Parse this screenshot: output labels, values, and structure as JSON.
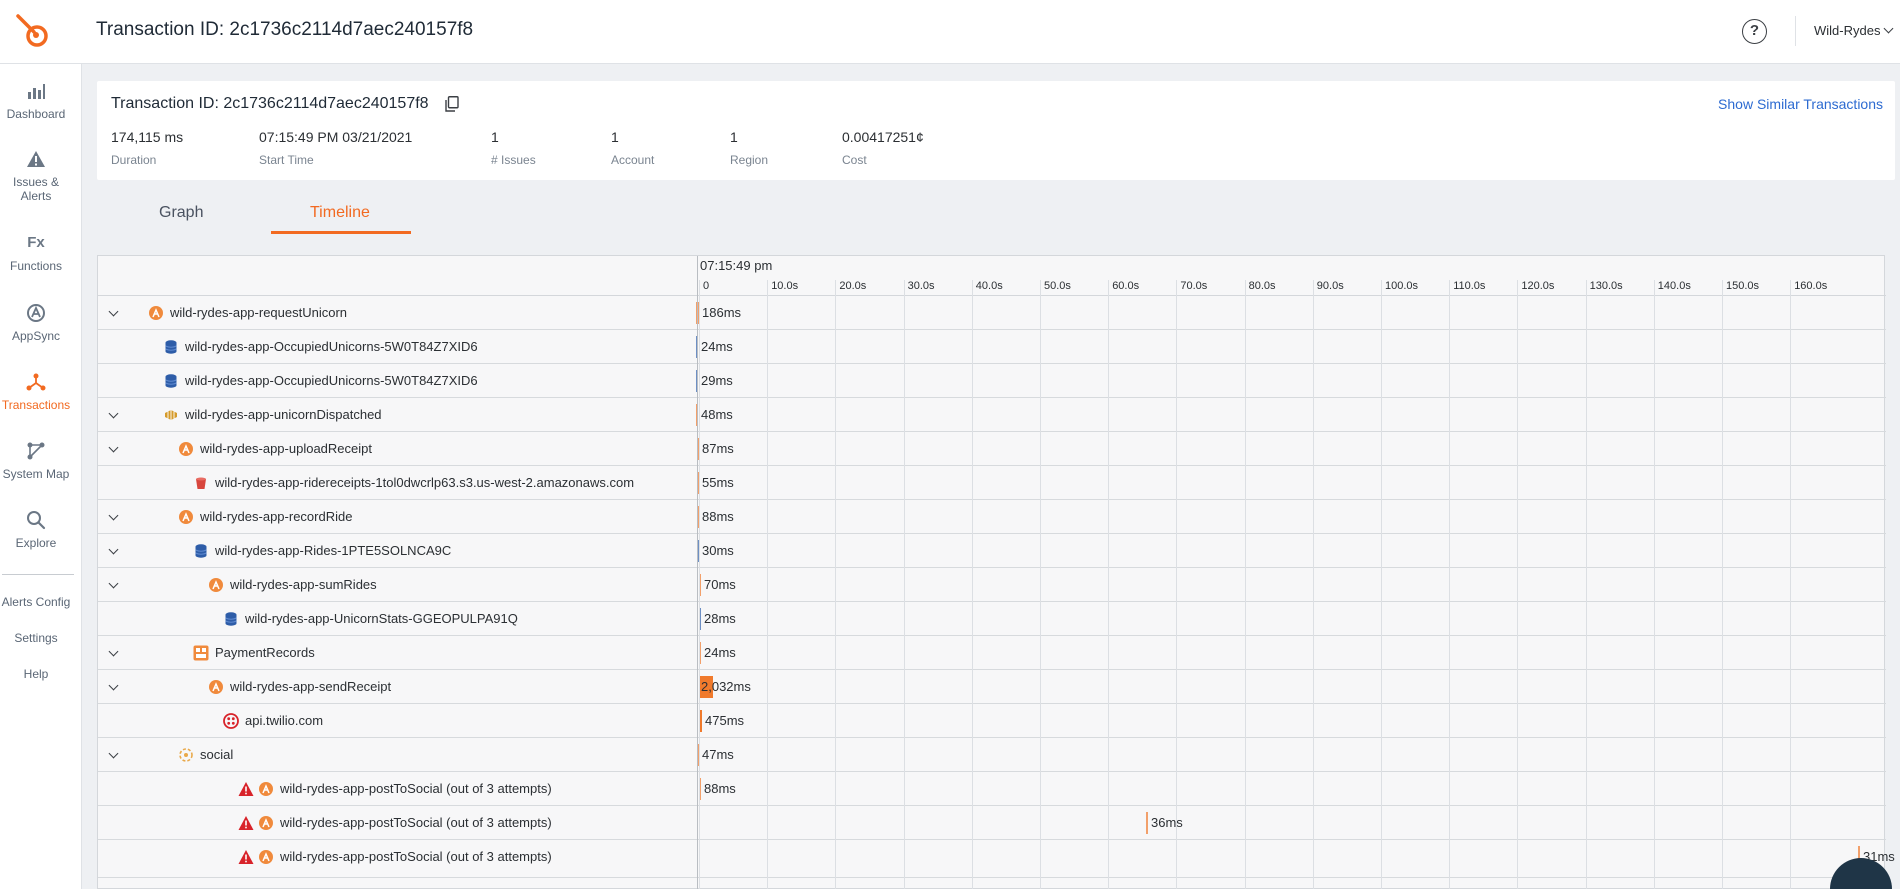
{
  "app": {
    "title": "Transaction ID: 2c1736c2114d7aec240157f8",
    "help_label": "?",
    "account": "Wild-Rydes"
  },
  "sidebar": {
    "items": [
      {
        "label": "Dashboard",
        "icon": "bar-chart-icon"
      },
      {
        "label": "Issues & Alerts",
        "icon": "warning-icon"
      },
      {
        "label": "Functions",
        "icon": "function-icon"
      },
      {
        "label": "AppSync",
        "icon": "appsync-icon"
      },
      {
        "label": "Transactions",
        "icon": "transactions-icon",
        "active": true
      },
      {
        "label": "System Map",
        "icon": "system-map-icon"
      },
      {
        "label": "Explore",
        "icon": "search-icon"
      }
    ],
    "links": [
      "Alerts Config",
      "Settings",
      "Help"
    ],
    "fx_glyph": "Fx"
  },
  "summary": {
    "title": "Transaction ID: 2c1736c2114d7aec240157f8",
    "similar_link": "Show Similar Transactions",
    "metrics": [
      {
        "value": "174,115 ms",
        "label": "Duration"
      },
      {
        "value": "07:15:49 PM 03/21/2021",
        "label": "Start Time"
      },
      {
        "value": "1",
        "label": "# Issues"
      },
      {
        "value": "1",
        "label": "Account"
      },
      {
        "value": "1",
        "label": "Region"
      },
      {
        "value": "0.00417251¢",
        "label": "Cost"
      }
    ]
  },
  "tabs": [
    {
      "label": "Graph",
      "active": false
    },
    {
      "label": "Timeline",
      "active": true
    }
  ],
  "timeline": {
    "start_time": "07:15:49 pm",
    "ticks": [
      "0",
      "10.0s",
      "20.0s",
      "30.0s",
      "40.0s",
      "50.0s",
      "60.0s",
      "70.0s",
      "80.0s",
      "90.0s",
      "100.0s",
      "110.0s",
      "120.0s",
      "130.0s",
      "140.0s",
      "150.0s",
      "160.0s"
    ],
    "rows": [
      {
        "name": "wild-rydes-app-requestUnicorn",
        "duration": "186ms",
        "icon": "lambda-icon",
        "expandable": true
      },
      {
        "name": "wild-rydes-app-OccupiedUnicorns-5W0T84Z7XID6",
        "duration": "24ms",
        "icon": "dynamodb-icon",
        "expandable": false
      },
      {
        "name": "wild-rydes-app-OccupiedUnicorns-5W0T84Z7XID6",
        "duration": "29ms",
        "icon": "dynamodb-icon",
        "expandable": false
      },
      {
        "name": "wild-rydes-app-unicornDispatched",
        "duration": "48ms",
        "icon": "sns-icon",
        "expandable": true
      },
      {
        "name": "wild-rydes-app-uploadReceipt",
        "duration": "87ms",
        "icon": "lambda-icon",
        "expandable": true
      },
      {
        "name": "wild-rydes-app-ridereceipts-1tol0dwcrlp63.s3.us-west-2.amazonaws.com",
        "duration": "55ms",
        "icon": "s3-bucket-icon",
        "expandable": false
      },
      {
        "name": "wild-rydes-app-recordRide",
        "duration": "88ms",
        "icon": "lambda-icon",
        "expandable": true
      },
      {
        "name": "wild-rydes-app-Rides-1PTE5SOLNCA9C",
        "duration": "30ms",
        "icon": "dynamodb-icon",
        "expandable": true
      },
      {
        "name": "wild-rydes-app-sumRides",
        "duration": "70ms",
        "icon": "lambda-icon",
        "expandable": true
      },
      {
        "name": "wild-rydes-app-UnicornStats-GGEOPULPA91Q",
        "duration": "28ms",
        "icon": "dynamodb-icon",
        "expandable": false
      },
      {
        "name": "PaymentRecords",
        "duration": "24ms",
        "icon": "payment-records-icon",
        "expandable": true
      },
      {
        "name": "wild-rydes-app-sendReceipt",
        "duration": "2,032ms",
        "icon": "lambda-icon",
        "expandable": true
      },
      {
        "name": "api.twilio.com",
        "duration": "475ms",
        "icon": "twilio-icon",
        "expandable": false
      },
      {
        "name": "social",
        "duration": "47ms",
        "icon": "social-icon",
        "expandable": true
      },
      {
        "name": "wild-rydes-app-postToSocial (out of 3 attempts)",
        "duration": "88ms",
        "icon": "lambda-icon",
        "expandable": false,
        "issue": true
      },
      {
        "name": "wild-rydes-app-postToSocial (out of 3 attempts)",
        "duration": "36ms",
        "icon": "lambda-icon",
        "expandable": false,
        "issue": true
      },
      {
        "name": "wild-rydes-app-postToSocial (out of 3 attempts)",
        "duration": "31ms",
        "icon": "lambda-icon",
        "expandable": false,
        "issue": true
      }
    ]
  },
  "colors": {
    "accent": "#f26a21",
    "link": "#2d6bd1",
    "lambda": "#f08a3c",
    "dynamodb": "#2e5da8",
    "error": "#d8232a"
  }
}
